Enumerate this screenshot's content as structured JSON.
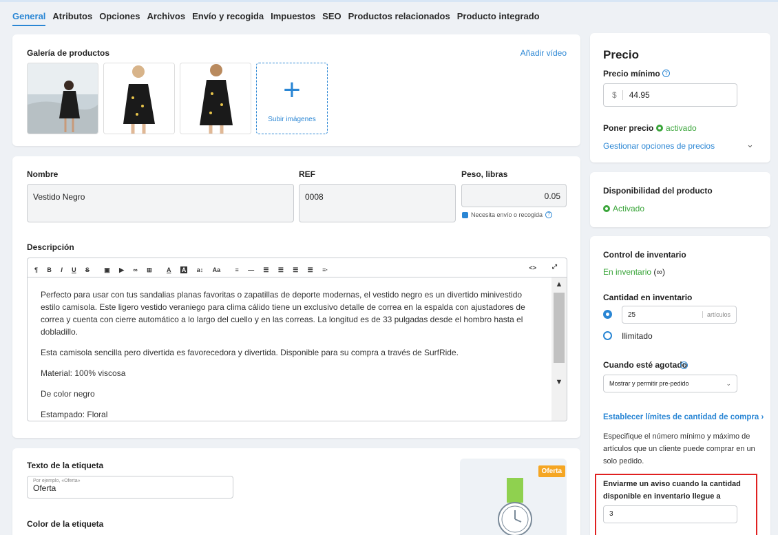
{
  "tabs": [
    "General",
    "Atributos",
    "Opciones",
    "Archivos",
    "Envío y recogida",
    "Impuestos",
    "SEO",
    "Productos relacionados",
    "Producto integrado"
  ],
  "gallery": {
    "title": "Galería de productos",
    "add_video": "Añadir vídeo",
    "upload": "Subir imágenes"
  },
  "fields": {
    "name_label": "Nombre",
    "name_value": "Vestido Negro",
    "ref_label": "REF",
    "ref_value": "0008",
    "weight_label": "Peso, libras",
    "weight_value": "0.05",
    "shipping_checkbox": "Necesita envío o recogida"
  },
  "description": {
    "label": "Descripción",
    "toolbar": [
      "¶",
      "B",
      "I",
      "U",
      "S",
      "▣",
      "▶",
      "∞",
      "⊞",
      "A",
      "A",
      "a↕",
      "Aa",
      "≡",
      "—",
      "☰",
      "☰",
      "☰",
      "☰",
      "≡·"
    ],
    "paragraphs": [
      "Perfecto para usar con tus sandalias planas favoritas o zapatillas de deporte modernas, el vestido negro es un divertido minivestido estilo camisola. Este ligero vestido veraniego para clima cálido tiene un exclusivo detalle de correa en la espalda con ajustadores de correa y cuenta con cierre automático a lo largo del cuello y en las correas. La longitud es de 33 pulgadas desde el hombro hasta el dobladillo.",
      "Esta camisola sencilla pero divertida es favorecedora y divertida. Disponible para su compra a través de SurfRide.",
      "Material: 100% viscosa",
      "De color negro",
      "Estampado: Floral"
    ]
  },
  "label_section": {
    "text_label": "Texto de la etiqueta",
    "placeholder_hint": "Por ejemplo, «Oferta»",
    "value": "Oferta",
    "color_label": "Color de la etiqueta",
    "badge": "Oferta"
  },
  "price": {
    "title": "Precio",
    "min_label": "Precio mínimo",
    "currency": "$",
    "value": "44.95",
    "set_price": "Poner precio",
    "set_price_status": "activado",
    "manage": "Gestionar opciones de precios"
  },
  "availability": {
    "title": "Disponibilidad del producto",
    "status": "Activado"
  },
  "inventory": {
    "control_label": "Control de inventario",
    "in_stock": "En inventario",
    "infinite": "(∞)",
    "qty_label": "Cantidad en inventario",
    "qty_value": "25",
    "qty_unit": "artículos",
    "unlimited": "Ilimitado",
    "out_label": "Cuando esté agotado",
    "out_option": "Mostrar y permitir pre-pedido",
    "limits_link": "Establecer límites de cantidad de compra",
    "limits_desc": "Especifique el número mínimo y máximo de artículos que un cliente puede comprar en un solo pedido.",
    "notify_label": "Enviarme un aviso cuando la cantidad disponible en inventario llegue a",
    "notify_value": "3"
  },
  "colors": {
    "accent": "#2a86d4",
    "green": "#3aa53a",
    "highlight": "#e02020",
    "badge": "#f5a623"
  }
}
